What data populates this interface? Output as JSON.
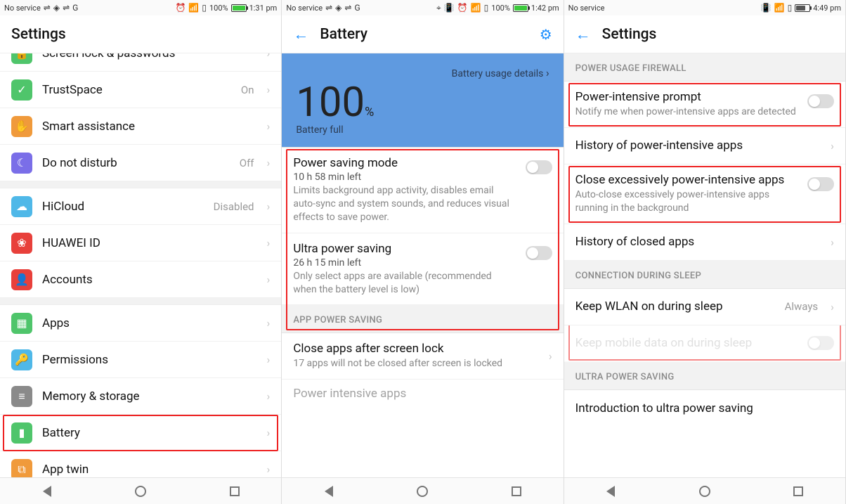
{
  "screen1": {
    "statusbar": {
      "left": "No service",
      "batt": "100%",
      "time": "1:31 pm",
      "batt_fill": "100%"
    },
    "title": "Settings",
    "items": [
      {
        "name": "screen-lock",
        "icon": "🔒",
        "color": "#4fc56b",
        "label": "Screen lock & passwords",
        "value": "",
        "cutoff": true
      },
      {
        "name": "trustspace",
        "icon": "✓",
        "color": "#4fc56b",
        "label": "TrustSpace",
        "value": "On"
      },
      {
        "name": "smart-assistance",
        "icon": "✋",
        "color": "#f09a3b",
        "label": "Smart assistance",
        "value": ""
      },
      {
        "name": "do-not-disturb",
        "icon": "☾",
        "color": "#7a6ee8",
        "label": "Do not disturb",
        "value": "Off"
      },
      {
        "gap": true
      },
      {
        "name": "hicloud",
        "icon": "☁",
        "color": "#4fb8e8",
        "label": "HiCloud",
        "value": "Disabled"
      },
      {
        "name": "huawei-id",
        "icon": "❀",
        "color": "#e8403b",
        "label": "HUAWEI ID",
        "value": ""
      },
      {
        "name": "accounts",
        "icon": "👤",
        "color": "#e8403b",
        "label": "Accounts",
        "value": ""
      },
      {
        "gap": true
      },
      {
        "name": "apps",
        "icon": "▦",
        "color": "#4fc56b",
        "label": "Apps",
        "value": ""
      },
      {
        "name": "permissions",
        "icon": "🔑",
        "color": "#4fb8e8",
        "label": "Permissions",
        "value": ""
      },
      {
        "name": "memory-storage",
        "icon": "≡",
        "color": "#8a8a8a",
        "label": "Memory & storage",
        "value": ""
      },
      {
        "name": "battery",
        "icon": "▮",
        "color": "#4fc56b",
        "label": "Battery",
        "value": "",
        "highlight": true
      },
      {
        "name": "app-twin",
        "icon": "⧉",
        "color": "#f09a3b",
        "label": "App twin",
        "value": "",
        "cutbottom": true
      }
    ]
  },
  "screen2": {
    "statusbar": {
      "left": "No service",
      "batt": "100%",
      "time": "1:42 pm",
      "batt_fill": "100%"
    },
    "title": "Battery",
    "hero": {
      "details": "Battery usage details",
      "pct": "100",
      "pct_unit": "%",
      "status": "Battery full"
    },
    "mode1": {
      "title": "Power saving mode",
      "sub2": "10 h 58 min left",
      "sub": "Limits background app activity, disables email auto-sync and system sounds, and reduces visual effects to save power."
    },
    "mode2": {
      "title": "Ultra power saving",
      "sub2": "26 h 15 min left",
      "sub": "Only select apps are available (recommended when the battery level is low)"
    },
    "sect1": "APP POWER SAVING",
    "close_apps": {
      "title": "Close apps after screen lock",
      "sub": "17 apps will not be closed after screen is locked"
    },
    "cutlast": "Power-intensive apps"
  },
  "screen3": {
    "statusbar": {
      "left": "No service",
      "batt": "",
      "time": "4:49 pm",
      "batt_fill": "62%"
    },
    "title": "Settings",
    "sect1": "POWER USAGE FIREWALL",
    "prompt": {
      "title": "Power-intensive prompt",
      "sub": "Notify me when power-intensive apps are detected"
    },
    "history": "History of power-intensive apps",
    "closeex": {
      "title": "Close excessively power-intensive apps",
      "sub": "Auto-close excessively power-intensive apps running in the background"
    },
    "history2": "History of closed apps",
    "sect2": "CONNECTION DURING SLEEP",
    "wlan": {
      "title": "Keep WLAN on during sleep",
      "value": "Always"
    },
    "mobile": "Keep mobile data on during sleep",
    "sect3": "ULTRA POWER SAVING",
    "intro": "Introduction to ultra power saving"
  }
}
